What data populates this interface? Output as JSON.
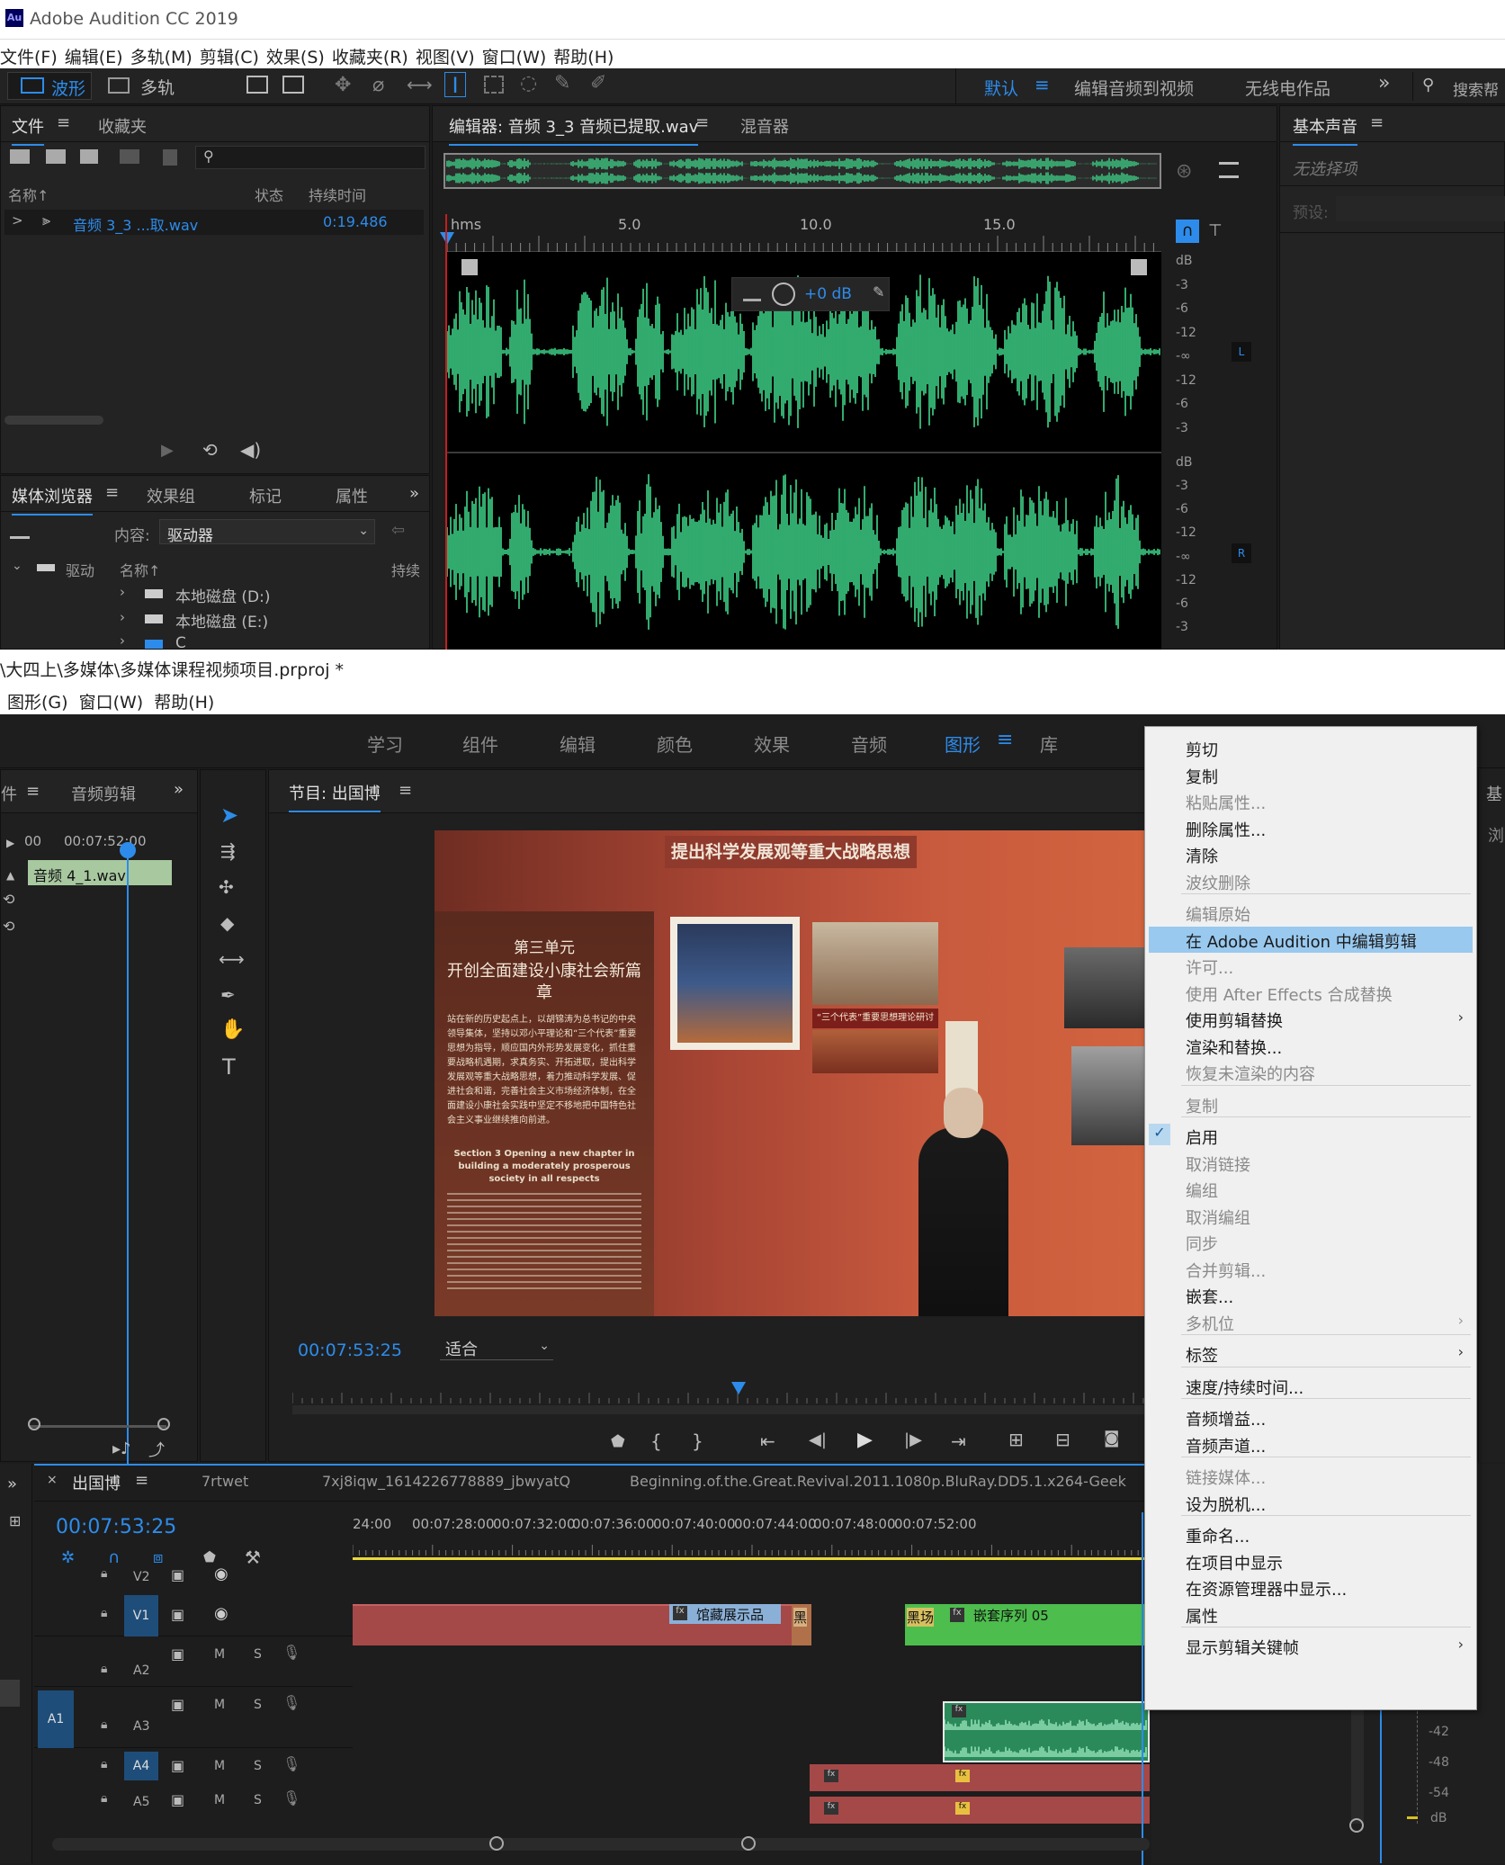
{
  "audition": {
    "app_title": "Adobe Audition CC 2019",
    "app_icon": "Au",
    "menu": [
      "文件(F)",
      "编辑(E)",
      "多轨(M)",
      "剪辑(C)",
      "效果(S)",
      "收藏夹(R)",
      "视图(V)",
      "窗口(W)",
      "帮助(H)"
    ],
    "toolbar": {
      "waveform_label": "波形",
      "multitrack_label": "多轨",
      "workspaces": [
        "默认",
        "编辑音频到视频",
        "无线电作品"
      ],
      "overflow": "»",
      "search_placeholder": "搜索帮"
    },
    "files_panel": {
      "tabs": [
        "文件",
        "收藏夹"
      ],
      "columns": [
        "名称",
        "状态",
        "持续时间"
      ],
      "sort_arrow": "↑",
      "expand": ">",
      "file_name": "音频 3_3 ...取.wav",
      "file_duration": "0:19.486"
    },
    "media_browser": {
      "tabs": [
        "媒体浏览器",
        "效果组",
        "标记",
        "属性"
      ],
      "overflow": "»",
      "content_label": "内容:",
      "content_value": "驱动器",
      "col_drives": "驱动",
      "col_name": "名称",
      "col_duration": "持续",
      "drives": [
        "本地磁盘 (D:)",
        "本地磁盘 (E:)",
        "C"
      ]
    },
    "editor": {
      "tab_editor": "编辑器: 音频 3_3 音频已提取.wav",
      "tab_mixer": "混音器",
      "ruler_unit": "hms",
      "ruler_ticks": [
        "5.0",
        "10.0",
        "15.0"
      ],
      "hud_gain": "+0 dB",
      "db_scale_top": [
        "dB",
        "-3",
        "-6",
        "-12",
        "-∞",
        "-12",
        "-6",
        "-3"
      ],
      "db_scale_bottom": [
        "dB",
        "-3",
        "-6",
        "-12",
        "-∞",
        "-12",
        "-6",
        "-3"
      ],
      "channel_l": "L",
      "channel_r": "R",
      "wave_color": "#3fd68a"
    },
    "basic_sound": {
      "title": "基本声音",
      "no_selection": "无选择项",
      "preset_label": "预设:"
    }
  },
  "premiere": {
    "title_path": "\\大四上\\多媒体\\多媒体课程视频项目.prproj *",
    "menu": [
      "图形(G)",
      "窗口(W)",
      "帮助(H)"
    ],
    "workspaces": [
      "学习",
      "组件",
      "编辑",
      "颜色",
      "效果",
      "音频",
      "图形",
      "库"
    ],
    "active_workspace": "图形",
    "source": {
      "tab_left": "件",
      "tab_audio": "音频剪辑",
      "overflow": "»",
      "time_left": "00",
      "time_marker": "00:07:52:00",
      "clip_label": "音频 4_1.wav"
    },
    "program": {
      "title": "节目: 出国博",
      "timecode": "00:07:53:25",
      "fit_label": "适合",
      "image_banner": "提出科学发展观等重大战略思想",
      "image_section": "第三单元",
      "image_headline": "开创全面建设小康社会新篇章",
      "image_body": "站在新的历史起点上，以胡锦涛为总书记的中央领导集体，坚持以邓小平理论和“三个代表”重要思想为指导，顺应国内外形势发展变化，抓住重要战略机遇期，求真务实、开拓进取，提出科学发展观等重大战略思想，着力推动科学发展、促进社会和谐，完善社会主义市场经济体制，在全面建设小康社会实践中坚定不移地把中国特色社会主义事业继续推向前进。",
      "image_en_title": "Section 3 Opening a new chapter in building a moderately prosperous society in all respects",
      "image_photo_label": "“三个代表”重要思想理论研讨会",
      "right_tab": "基",
      "right_tab2": "浏"
    },
    "timeline": {
      "overflow": "»",
      "close": "×",
      "tabs": [
        "出国博",
        "7rtwet",
        "7xj8iqw_1614226778889_jbwyatQ",
        "Beginning.of.the.Great.Revival.2011.1080p.BluRay.DD5.1.x264-Geek"
      ],
      "timecode": "00:07:53:25",
      "ruler": [
        "24:00",
        "00:07:28:00",
        "00:07:32:00",
        "00:07:36:00",
        "00:07:40:00",
        "00:07:44:00",
        "00:07:48:00",
        "00:07:52:00"
      ],
      "tracks": [
        "V2",
        "V1",
        "A2",
        "A3",
        "A4",
        "A5"
      ],
      "source_patch": "A1",
      "m": "M",
      "s": "S",
      "clips": {
        "museum": "馆藏展示品",
        "black_short": "黑",
        "black": "黑场",
        "nested": "嵌套序列 05",
        "fx": "fx"
      },
      "meter_labels": [
        "-42",
        "-48",
        "-54",
        "dB"
      ]
    },
    "context_menu": {
      "items": [
        {
          "label": "剪切",
          "enabled": true
        },
        {
          "label": "复制",
          "enabled": true
        },
        {
          "label": "粘贴属性...",
          "enabled": false
        },
        {
          "label": "删除属性...",
          "enabled": true
        },
        {
          "label": "清除",
          "enabled": true
        },
        {
          "label": "波纹删除",
          "enabled": false
        },
        {
          "label": "编辑原始",
          "enabled": false
        },
        {
          "label": "在 Adobe Audition 中编辑剪辑",
          "enabled": true,
          "highlighted": true
        },
        {
          "label": "许可...",
          "enabled": false
        },
        {
          "label": "使用 After Effects 合成替换",
          "enabled": false
        },
        {
          "label": "使用剪辑替换",
          "enabled": true,
          "submenu": true
        },
        {
          "label": "渲染和替换...",
          "enabled": true
        },
        {
          "label": "恢复未渲染的内容",
          "enabled": false
        },
        {
          "label": "复制",
          "enabled": false
        },
        {
          "label": "启用",
          "enabled": true,
          "checked": true
        },
        {
          "label": "取消链接",
          "enabled": false
        },
        {
          "label": "编组",
          "enabled": false
        },
        {
          "label": "取消编组",
          "enabled": false
        },
        {
          "label": "同步",
          "enabled": false
        },
        {
          "label": "合并剪辑...",
          "enabled": false
        },
        {
          "label": "嵌套...",
          "enabled": true
        },
        {
          "label": "多机位",
          "enabled": false,
          "submenu": true
        },
        {
          "label": "标签",
          "enabled": true,
          "submenu": true
        },
        {
          "label": "速度/持续时间...",
          "enabled": true
        },
        {
          "label": "音频增益...",
          "enabled": true
        },
        {
          "label": "音频声道...",
          "enabled": true
        },
        {
          "label": "链接媒体...",
          "enabled": false
        },
        {
          "label": "设为脱机...",
          "enabled": true
        },
        {
          "label": "重命名...",
          "enabled": true
        },
        {
          "label": "在项目中显示",
          "enabled": true
        },
        {
          "label": "在资源管理器中显示...",
          "enabled": true
        },
        {
          "label": "属性",
          "enabled": true
        },
        {
          "label": "显示剪辑关键帧",
          "enabled": true,
          "submenu": true
        }
      ]
    }
  }
}
